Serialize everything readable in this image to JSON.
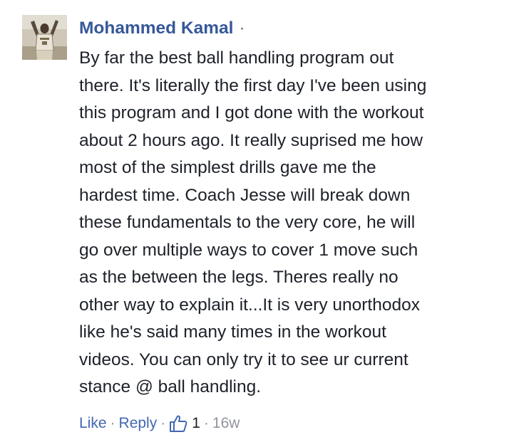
{
  "comment": {
    "author": "Mohammed Kamal",
    "header_separator": "·",
    "avatar_icon": "user-avatar-basketball-player",
    "text": "By far the best ball handling program out there. It's literally the first day I've been using this program and I got done with the workout about 2 hours ago. It really suprised me how most of the simplest drills gave me the hardest time. Coach Jesse will break down these fundamentals to the very core, he will go over multiple ways to cover 1 move such as the between the legs. Theres really no other way to explain it...It is very unorthodox like he's said many times in the workout videos. You can only try it to see ur current stance @ ball handling.",
    "lines": [
      "By far the best ball handling program out",
      "there. It's literally the first day I've been using",
      "this program and I got done with the workout",
      "about 2 hours ago. It really suprised me how",
      "most of the simplest drills gave me the",
      "hardest time. Coach Jesse will break down",
      "these fundamentals to the very core, he will",
      "go over multiple ways to cover 1 move such",
      "as the between the legs. Theres really no",
      "other way to explain it...It is very unorthodox",
      "like he's said many times in the workout",
      "videos. You can only try it to see ur current",
      "stance @ ball handling."
    ]
  },
  "actions": {
    "like_label": "Like",
    "reply_label": "Reply",
    "separator": "·",
    "like_icon": "thumbs-up-icon",
    "like_count": "1",
    "timestamp": "16w"
  },
  "colors": {
    "author_link": "#365899",
    "action_link": "#4267b2",
    "body_text": "#1d2129",
    "muted": "#90949c"
  }
}
